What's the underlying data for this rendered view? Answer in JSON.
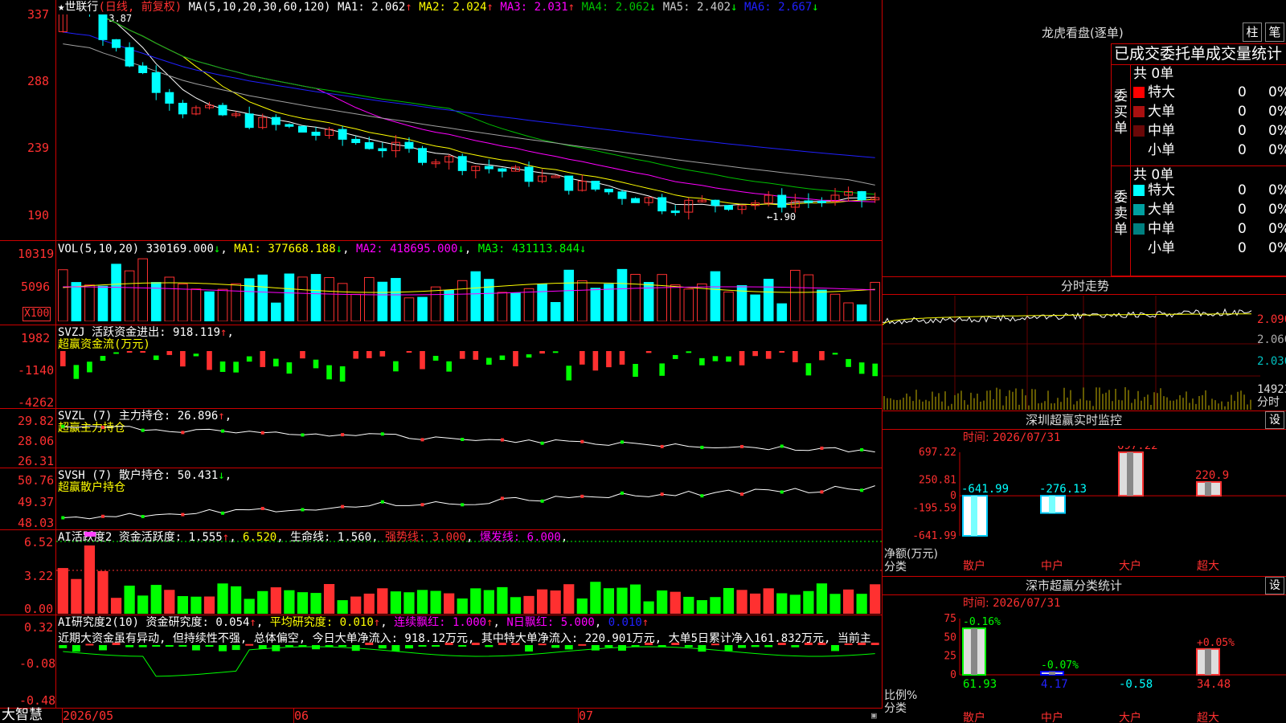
{
  "colors": {
    "up": "#ff3030",
    "down": "#00ffff",
    "green": "#00ff00",
    "frame": "#c00000",
    "ma1": "#ffffff",
    "ma2": "#ffff00",
    "ma3": "#ff00ff",
    "ma4": "#00c000",
    "ma5": "#a0a0a0",
    "ma6": "#2020ff"
  },
  "price_panel": {
    "star": "★",
    "name": "世联行",
    "mode": "(日线, 前复权)",
    "ma_title": "MA(5,10,20,30,60,120)",
    "ma": [
      {
        "label": "MA1: ",
        "value": "2.062",
        "arrow": "↑"
      },
      {
        "label": "MA2: ",
        "value": "2.024",
        "arrow": "↑"
      },
      {
        "label": "MA3: ",
        "value": "2.031",
        "arrow": "↑"
      },
      {
        "label": "MA4: ",
        "value": "2.062",
        "arrow": "↓"
      },
      {
        "label": "MA5: ",
        "value": "2.402",
        "arrow": "↓"
      },
      {
        "label": "MA6: ",
        "value": "2.667",
        "arrow": "↓"
      }
    ],
    "y_ticks": [
      "337",
      "288",
      "239",
      "190"
    ],
    "high_label": "←3.87",
    "low_label": "←1.90"
  },
  "vol_panel": {
    "title": "VOL(5,10,20)",
    "value": "330169.000",
    "arrow": "↓",
    "ma": [
      {
        "label": "MA1: ",
        "value": "377668.188",
        "arrow": "↓"
      },
      {
        "label": "MA2: ",
        "value": "418695.000",
        "arrow": "↓"
      },
      {
        "label": "MA3: ",
        "value": "431113.844",
        "arrow": "↓"
      }
    ],
    "y_ticks": [
      "10319",
      "5096"
    ],
    "unit": "X100"
  },
  "svzj_panel": {
    "title": "SVZJ",
    "label": "活跃资金进出: ",
    "value": "918.119",
    "arrow": "↑",
    "subtitle": "超赢资金流(万元)",
    "y_ticks": [
      "1982",
      "-1140",
      "-4262"
    ]
  },
  "svzl_panel": {
    "title": "SVZL (7)",
    "label": "主力持仓: ",
    "value": "26.896",
    "arrow": "↑",
    "subtitle": "超赢主力持仓",
    "y_ticks": [
      "29.82",
      "28.06",
      "26.31"
    ]
  },
  "svsh_panel": {
    "title": "SVSH (7)",
    "label": "散户持仓: ",
    "value": "50.431",
    "arrow": "↓",
    "subtitle": "超赢散户持仓",
    "y_ticks": [
      "50.76",
      "49.37",
      "48.03"
    ]
  },
  "ai1_panel": {
    "title": "AI活跃度2",
    "l1": "资金活跃度: ",
    "v1": "1.555",
    "a1": "↑",
    "v2": "6.520",
    "l3": "生命线: ",
    "v3": "1.560",
    "l4": "强势线: ",
    "v4": "3.000",
    "l5": "爆发线: ",
    "v5": "6.000",
    "y_ticks": [
      "6.52",
      "3.22",
      "0.00"
    ]
  },
  "ai2_panel": {
    "title": "AI研究度2(10)",
    "l1": "资金研究度: ",
    "v1": "0.054",
    "a1": "↑",
    "l2": "平均研究度: ",
    "v2": "0.010",
    "a2": "↑",
    "l3": "连续飘红: ",
    "v3": "1.000",
    "a3": "↑",
    "l4": "N日飘红: ",
    "v4": "5.000",
    "v5": "0.010",
    "a5": "↑",
    "comment": "近期大资金虽有异动, 但持续性不强, 总体偏空, 今日大单净流入: 918.12万元, 其中特大单净流入: 220.901万元, 大单5日累计净入161.832万元, 当前主",
    "y_ticks": [
      "0.32",
      "-0.08",
      "-0.48"
    ]
  },
  "bottom": {
    "brand": "大智慧",
    "dates": [
      "2026/05",
      "06",
      "07"
    ]
  },
  "right": {
    "lhb": {
      "title": "龙虎看盘(逐单)",
      "tabs": [
        "柱",
        "笔"
      ],
      "header": "已成交委托单成交量统计",
      "buy": {
        "label": [
          "委",
          "买",
          "单"
        ],
        "total": "共 0单",
        "rows": [
          {
            "name": "特大",
            "color": "#ff0000",
            "count": "0",
            "pct": "0%"
          },
          {
            "name": "大单",
            "color": "#aa1010",
            "count": "0",
            "pct": "0%"
          },
          {
            "name": "中单",
            "color": "#6a0808",
            "count": "0",
            "pct": "0%"
          },
          {
            "name": "小单",
            "color": "",
            "count": "0",
            "pct": "0%"
          }
        ]
      },
      "sell": {
        "label": [
          "委",
          "卖",
          "单"
        ],
        "total": "共 0单",
        "rows": [
          {
            "name": "特大",
            "color": "#00ffff",
            "count": "0",
            "pct": "0%"
          },
          {
            "name": "大单",
            "color": "#00a0a0",
            "count": "0",
            "pct": "0%"
          },
          {
            "name": "中单",
            "color": "#008080",
            "count": "0",
            "pct": "0%"
          },
          {
            "name": "小单",
            "color": "",
            "count": "0",
            "pct": "0%"
          }
        ]
      }
    },
    "intraday": {
      "title": "分时走势",
      "y_ticks": [
        "2.090",
        "2.060",
        "2.030"
      ],
      "vol_label": "14923",
      "label": "分时"
    },
    "sz": {
      "title": "深圳超赢实时监控",
      "settings": "设",
      "time_label": "时间: ",
      "time": "2026/07/31",
      "y_ticks": [
        "697.22",
        "250.81",
        "0",
        "-195.59",
        "-641.99"
      ],
      "axis_label": "净额(万元)",
      "cat_label": "分类"
    },
    "cls": {
      "title": "深市超赢分类统计",
      "settings": "设",
      "time_label": "时间: ",
      "time": "2026/07/31",
      "y_ticks": [
        "75",
        "50",
        "25",
        "0"
      ],
      "axis_label": "比例%",
      "cat_label": "分类"
    }
  },
  "chart_data": [
    {
      "type": "bar",
      "title": "深圳超赢实时监控",
      "ylabel": "净额(万元)",
      "categories": [
        "散户",
        "中户",
        "大户",
        "超大"
      ],
      "values": [
        -641.99,
        -276.13,
        697.22,
        220.9
      ],
      "ylim": [
        -641.99,
        697.22
      ]
    },
    {
      "type": "bar",
      "title": "深市超赢分类统计",
      "ylabel": "比例%",
      "categories": [
        "散户",
        "中户",
        "大户",
        "超大"
      ],
      "values": [
        61.93,
        4.17,
        -0.58,
        34.48
      ],
      "changes": [
        "-0.16%",
        "-0.07%",
        "",
        "+0.05%"
      ],
      "ylim": [
        0,
        75
      ]
    }
  ]
}
